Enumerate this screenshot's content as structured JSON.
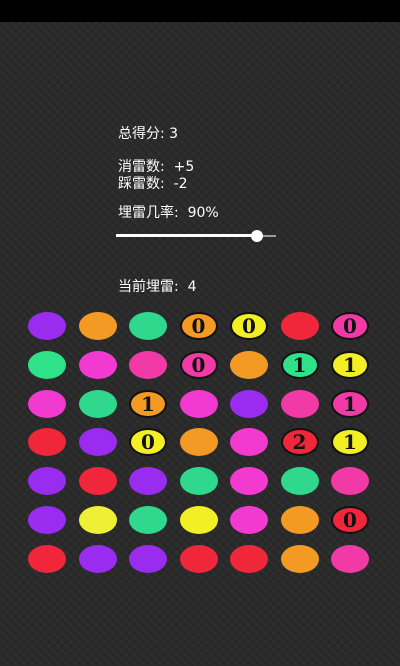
{
  "stats": {
    "score": "总得分: 3",
    "cleared": "消雷数:  +5",
    "stepped": "踩雷数:  -2",
    "mine_prob_label": "埋雷几率:  90%",
    "mine_prob_value": 0.9,
    "current_mines": "当前埋雷:  4"
  },
  "board": {
    "rows": [
      [
        {
          "color": "#9a2cf0",
          "label": ""
        },
        {
          "color": "#f39a25",
          "label": ""
        },
        {
          "color": "#2fd88c",
          "label": ""
        },
        {
          "color": "#f39a25",
          "label": "0"
        },
        {
          "color": "#f2f025",
          "label": "0"
        },
        {
          "color": "#f0263a",
          "label": ""
        },
        {
          "color": "#f23aa6",
          "label": "0"
        }
      ],
      [
        {
          "color": "#2fe28a",
          "label": ""
        },
        {
          "color": "#f23ad0",
          "label": ""
        },
        {
          "color": "#f23aa6",
          "label": ""
        },
        {
          "color": "#f23aa6",
          "label": "0"
        },
        {
          "color": "#f39a25",
          "label": ""
        },
        {
          "color": "#2fe28a",
          "label": "1"
        },
        {
          "color": "#f2f025",
          "label": "1"
        }
      ],
      [
        {
          "color": "#f23ad0",
          "label": ""
        },
        {
          "color": "#2fd88c",
          "label": ""
        },
        {
          "color": "#f39a25",
          "label": "1"
        },
        {
          "color": "#f23ad0",
          "label": ""
        },
        {
          "color": "#9a2cf0",
          "label": ""
        },
        {
          "color": "#f23aa6",
          "label": ""
        },
        {
          "color": "#f23aa6",
          "label": "1"
        }
      ],
      [
        {
          "color": "#f0263a",
          "label": ""
        },
        {
          "color": "#9a2cf0",
          "label": ""
        },
        {
          "color": "#f2f025",
          "label": "0"
        },
        {
          "color": "#f39a25",
          "label": ""
        },
        {
          "color": "#f23ad0",
          "label": ""
        },
        {
          "color": "#f0263a",
          "label": "2"
        },
        {
          "color": "#f2f025",
          "label": "1"
        }
      ],
      [
        {
          "color": "#9a2cf0",
          "label": ""
        },
        {
          "color": "#f0263a",
          "label": ""
        },
        {
          "color": "#9a2cf0",
          "label": ""
        },
        {
          "color": "#2fd88c",
          "label": ""
        },
        {
          "color": "#f23ad0",
          "label": ""
        },
        {
          "color": "#2fd88c",
          "label": ""
        },
        {
          "color": "#f23aa6",
          "label": ""
        }
      ],
      [
        {
          "color": "#9a2cf0",
          "label": ""
        },
        {
          "color": "#eef035",
          "label": ""
        },
        {
          "color": "#2fd88c",
          "label": ""
        },
        {
          "color": "#f2f025",
          "label": ""
        },
        {
          "color": "#f23ad0",
          "label": ""
        },
        {
          "color": "#f39a25",
          "label": ""
        },
        {
          "color": "#f0263a",
          "label": "0"
        }
      ],
      [
        {
          "color": "#f0263a",
          "label": ""
        },
        {
          "color": "#9a2cf0",
          "label": ""
        },
        {
          "color": "#9a2cf0",
          "label": ""
        },
        {
          "color": "#f0263a",
          "label": ""
        },
        {
          "color": "#f0263a",
          "label": ""
        },
        {
          "color": "#f39a25",
          "label": ""
        },
        {
          "color": "#f23aa6",
          "label": ""
        }
      ]
    ]
  }
}
